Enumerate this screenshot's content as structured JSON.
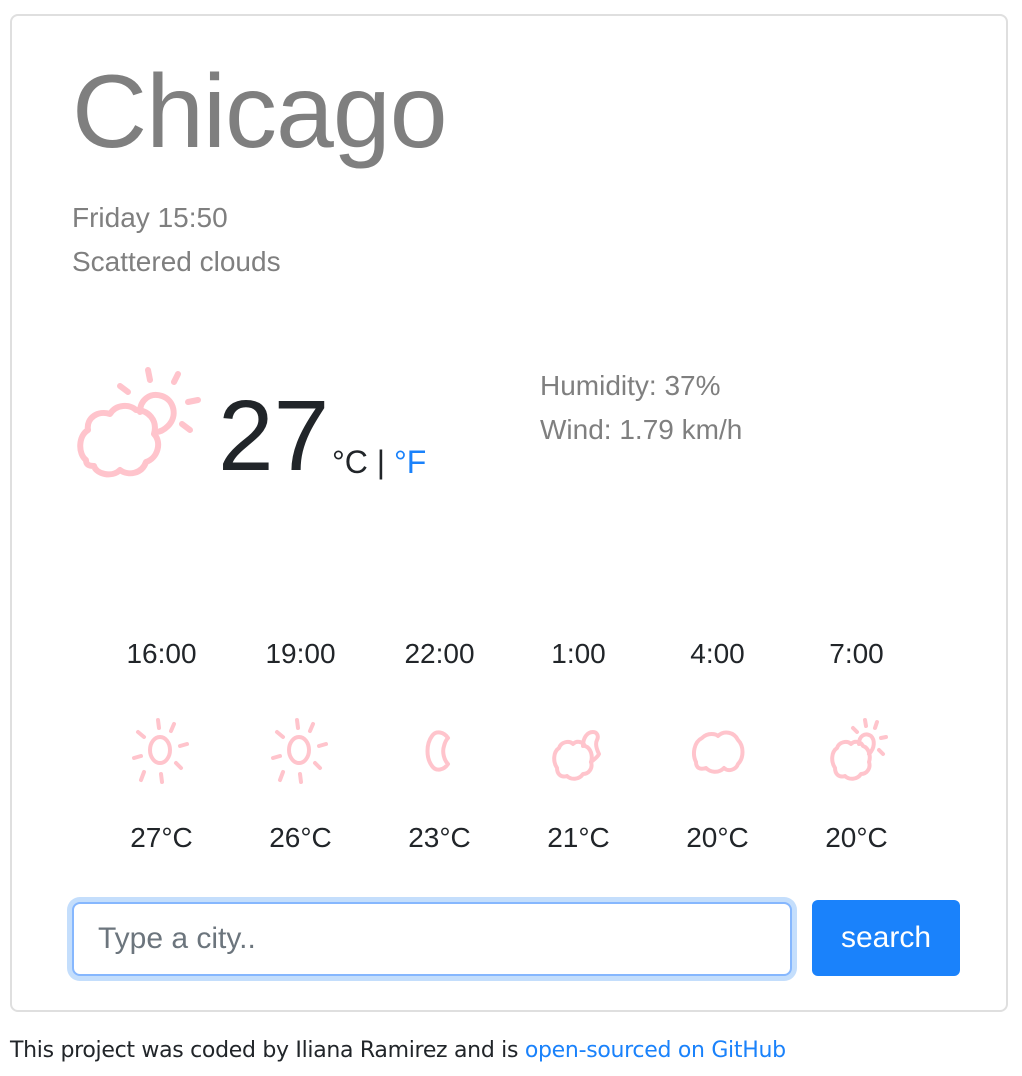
{
  "current": {
    "city": "Chicago",
    "date": "Friday 15:50",
    "description": "Scattered clouds",
    "icon": "cloud-sun-icon",
    "temperature": "27",
    "unit_celsius": "°C",
    "unit_separator": " | ",
    "unit_fahrenheit": "°F",
    "humidity": "Humidity: 37%",
    "wind": "Wind: 1.79 km/h"
  },
  "forecast": [
    {
      "time": "16:00",
      "icon": "sun-icon",
      "temp": "27°C"
    },
    {
      "time": "19:00",
      "icon": "sun-icon",
      "temp": "26°C"
    },
    {
      "time": "22:00",
      "icon": "moon-icon",
      "temp": "23°C"
    },
    {
      "time": "1:00",
      "icon": "cloud-moon-icon",
      "temp": "21°C"
    },
    {
      "time": "4:00",
      "icon": "cloud-icon",
      "temp": "20°C"
    },
    {
      "time": "7:00",
      "icon": "cloud-sun-icon",
      "temp": "20°C"
    }
  ],
  "search": {
    "placeholder": "Type a city..",
    "value": "",
    "button_label": "search"
  },
  "footer": {
    "text": "This project was coded by Iliana Ramirez and is ",
    "link_label": "open-sourced on GitHub"
  },
  "colors": {
    "accent": "#1a82fb",
    "icon": "#ffc4cc",
    "muted_text": "#7f7f7f"
  }
}
